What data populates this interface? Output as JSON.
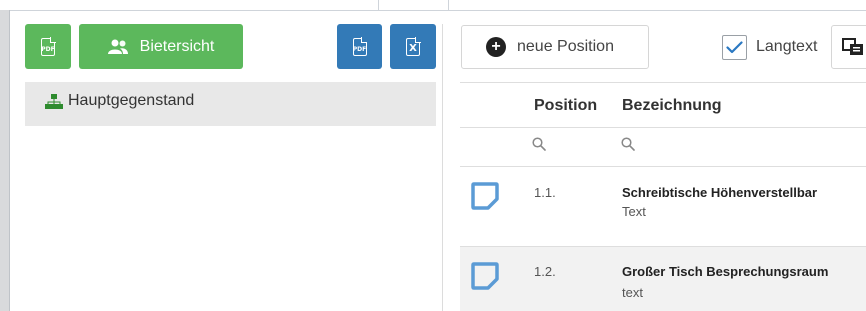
{
  "toolbar_left": {
    "pdf_label": "PDF",
    "bieter_label": "Bietersicht",
    "pdf2_label": "PDF",
    "excel_label": "X"
  },
  "tree": {
    "root_label": "Hauptgegenstand"
  },
  "toolbar_right": {
    "new_position_label": "neue Position",
    "langtext_label": "Langtext",
    "langtext_checked": true
  },
  "table": {
    "columns": [
      "Position",
      "Bezeichnung"
    ],
    "rows": [
      {
        "position": "1.1.",
        "title": "Schreibtische Höhenverstellbar",
        "sub": "Text"
      },
      {
        "position": "1.2.",
        "title": "Großer Tisch Besprechungsraum",
        "sub": "text"
      }
    ]
  },
  "colors": {
    "green": "#5cb85c",
    "blue": "#337ab7",
    "tree_icon_green": "#2e8b2e",
    "note_icon_blue": "#5b9bd5"
  }
}
